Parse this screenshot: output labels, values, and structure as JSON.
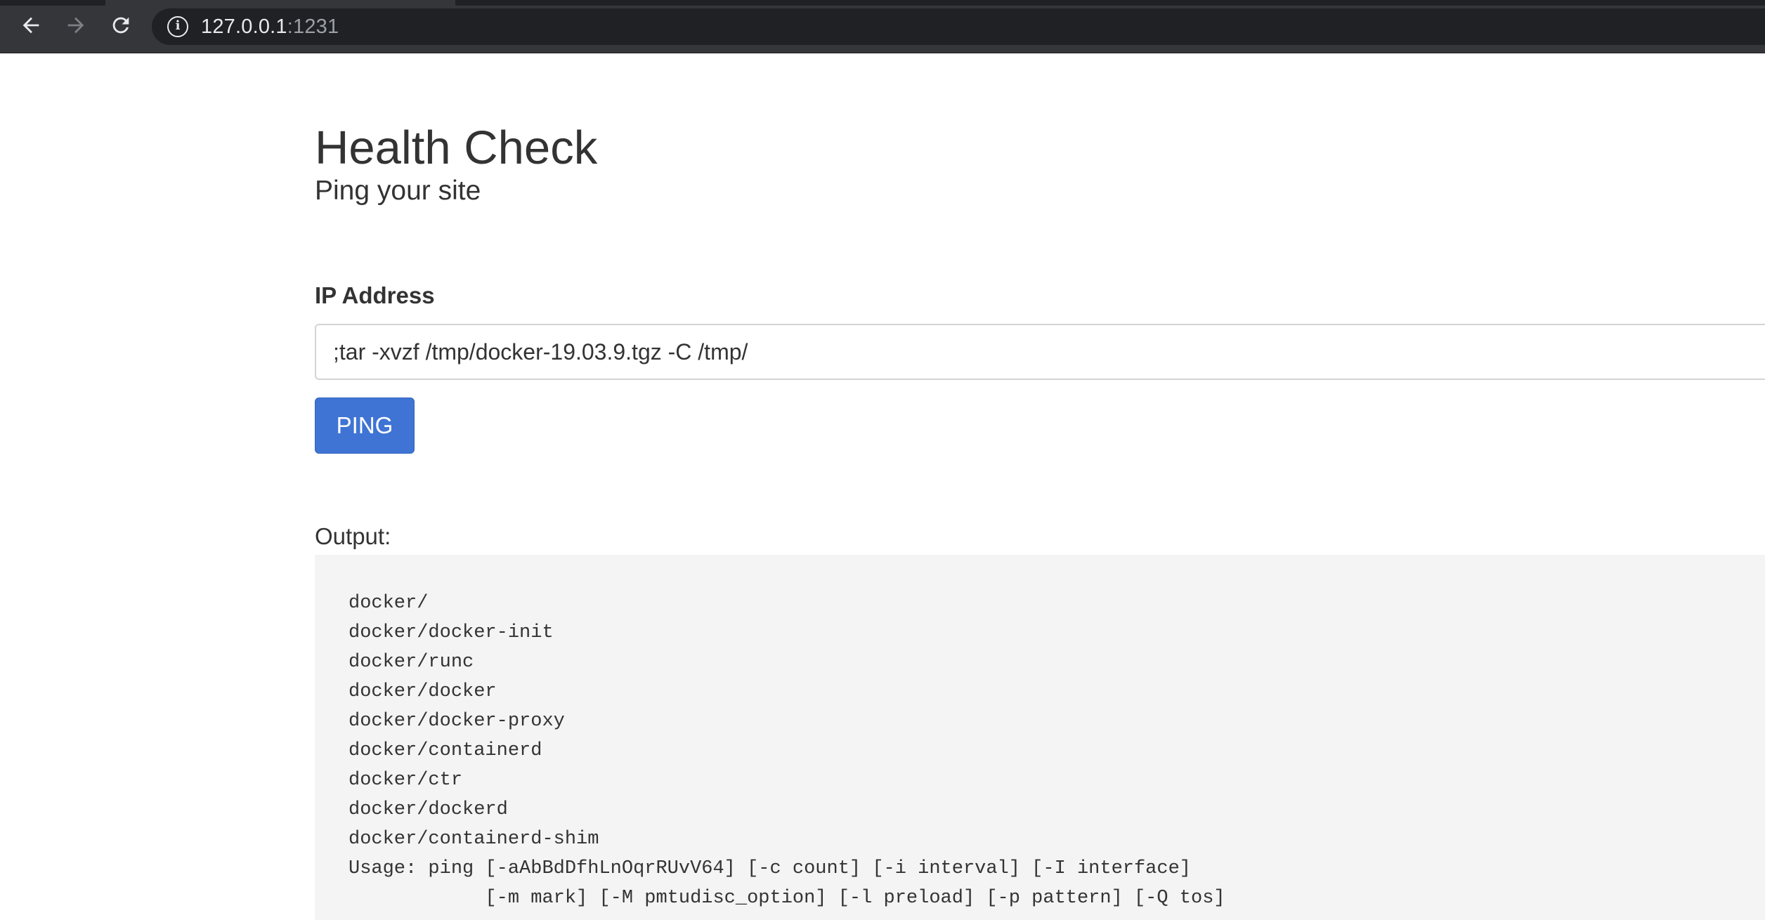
{
  "browser": {
    "url_host": "127.0.0.1",
    "url_port": ":1231",
    "icons": {
      "back": "arrow-left-icon",
      "forward": "arrow-right-icon",
      "reload": "reload-icon",
      "site_info": "info-icon"
    }
  },
  "page": {
    "title": "Health Check",
    "subtitle": "Ping your site",
    "form": {
      "ip_label": "IP Address",
      "ip_value": ";tar -xvzf /tmp/docker-19.03.9.tgz -C /tmp/",
      "ping_label": "PING"
    },
    "output": {
      "label": "Output:",
      "text": "docker/\ndocker/docker-init\ndocker/runc\ndocker/docker\ndocker/docker-proxy\ndocker/containerd\ndocker/ctr\ndocker/dockerd\ndocker/containerd-shim\nUsage: ping [-aAbBdDfhLnOqrRUvV64] [-c count] [-i interval] [-I interface]\n            [-m mark] [-M pmtudisc_option] [-l preload] [-p pattern] [-Q tos]"
    }
  },
  "colors": {
    "chrome_bg": "#35363a",
    "omnibox_bg": "#202124",
    "primary_button": "#3f74d5",
    "output_bg": "#f4f4f4",
    "text": "#333333"
  }
}
